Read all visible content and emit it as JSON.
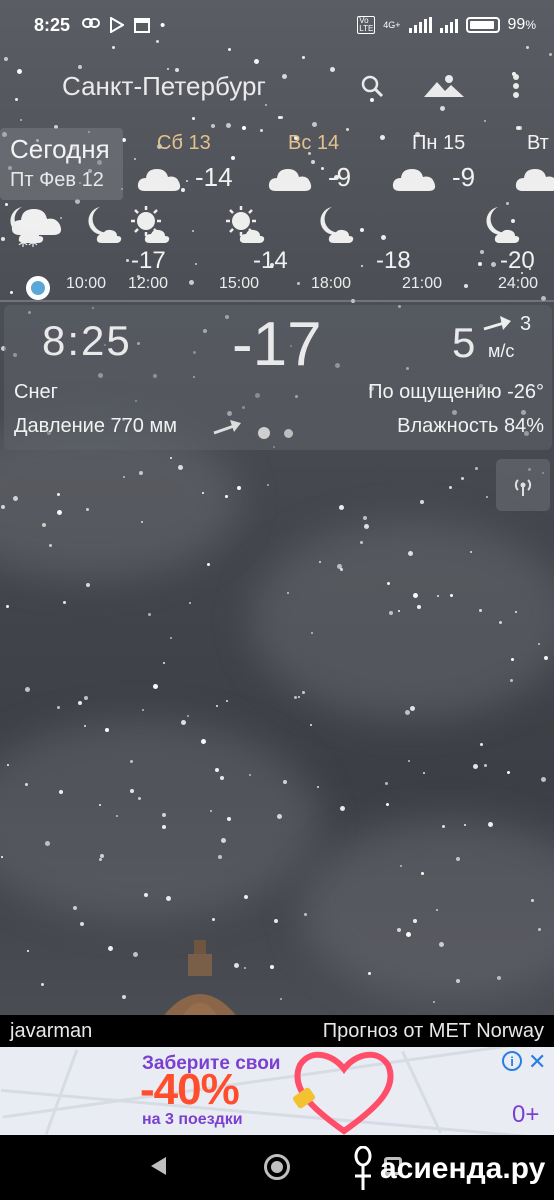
{
  "status_bar": {
    "time": "8:25",
    "network": "4G+",
    "volte": "Vo LTE",
    "battery_percent": "99",
    "battery_unit": "%"
  },
  "header": {
    "city": "Санкт-Петербург",
    "icons": [
      "search-icon",
      "landscape-icon",
      "more-vert-icon"
    ]
  },
  "today": {
    "label": "Сегодня",
    "date": "Пт Фев 12"
  },
  "days": [
    {
      "name": "Сб 13",
      "temp": "-14",
      "weekend": true,
      "icon": "cloud-icon"
    },
    {
      "name": "Вс 14",
      "temp": "-9",
      "weekend": true,
      "icon": "cloud-icon"
    },
    {
      "name": "Пн 15",
      "temp": "-9",
      "weekend": false,
      "icon": "cloud-icon"
    },
    {
      "name": "Вт",
      "temp": "",
      "weekend": false,
      "icon": "cloud-icon"
    }
  ],
  "hours": [
    {
      "time": "10:00",
      "temp": "",
      "icon": "snow-cloud-icon"
    },
    {
      "time": "12:00",
      "temp": "-17",
      "icon": "sun-cloud-icon"
    },
    {
      "time": "15:00",
      "temp": "-14",
      "icon": "sun-cloud-icon"
    },
    {
      "time": "18:00",
      "temp": "-18",
      "icon": "moon-cloud-icon"
    },
    {
      "time": "21:00",
      "temp": "",
      "icon": "moon-cloud-icon"
    },
    {
      "time": "24:00",
      "temp": "-20",
      "icon": "moon-cloud-icon"
    }
  ],
  "current": {
    "time": "8:25",
    "temp": "-17",
    "wind_speed": "5",
    "wind_dir_value": "3",
    "wind_unit": "м/с",
    "condition": "Снег",
    "feels_like": "По ощущению -26°",
    "pressure": "Давление 770 мм",
    "humidity": "Влажность 84%"
  },
  "footer": {
    "author": "javarman",
    "source": "Прогноз от MET Norway"
  },
  "ad": {
    "line1": "Заберите свои",
    "line2": "-40%",
    "line3": "на 3 поездки",
    "plus_label": "0+"
  },
  "watermark": "асиенда.ру",
  "colors": {
    "weekend": "#e3c18d",
    "now_dot": "#5aa7d8",
    "ad_purple": "#7b3fd1",
    "ad_orange": "#ff4d2e",
    "ad_blue": "#2a7de1"
  }
}
